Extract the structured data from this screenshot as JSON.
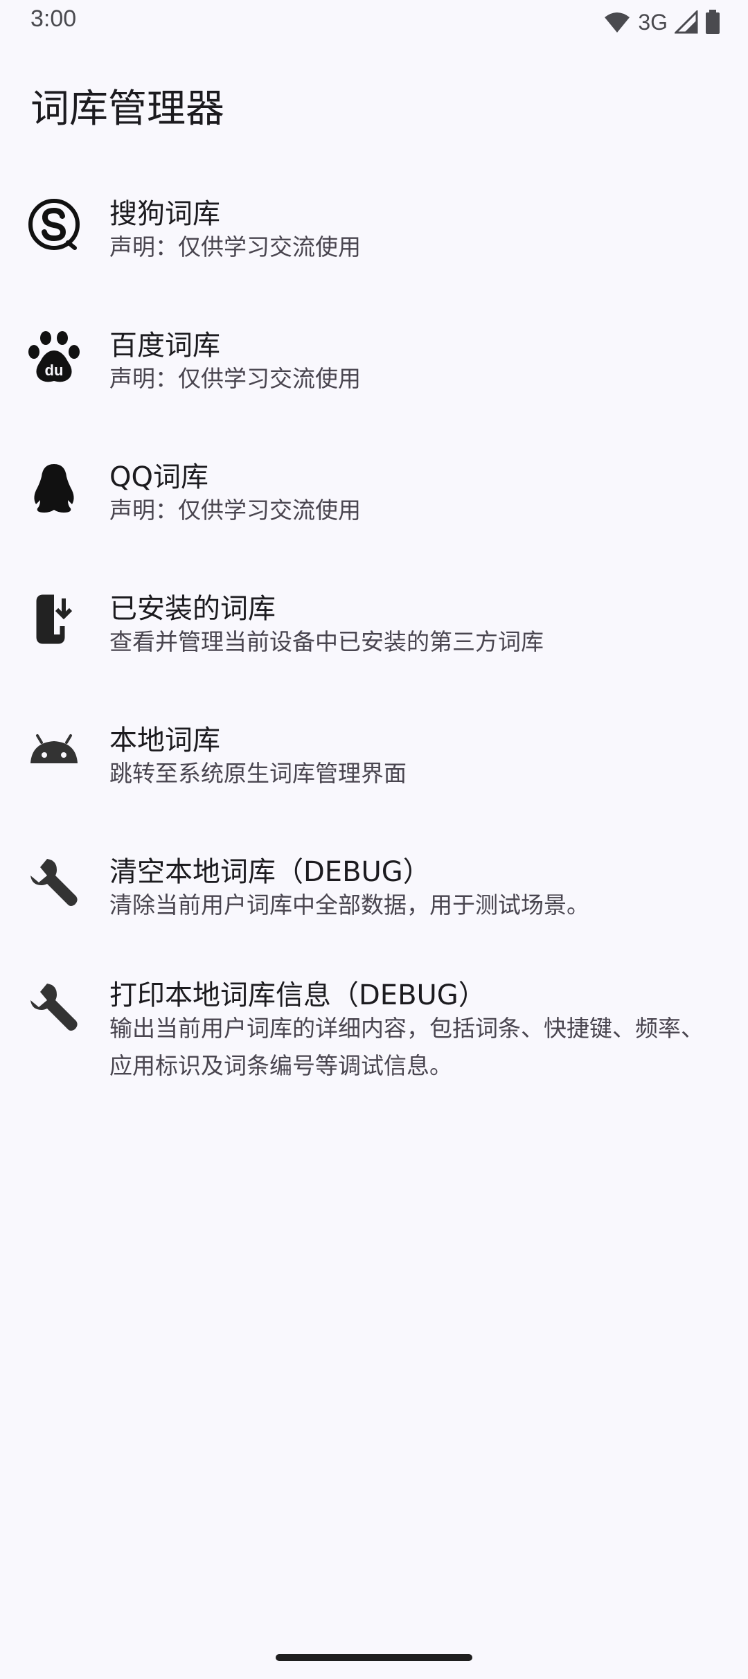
{
  "status_bar": {
    "time": "3:00",
    "network": "3G"
  },
  "title": "词库管理器",
  "items": [
    {
      "icon": "sogou-logo-icon",
      "title": "搜狗词库",
      "subtitle": "声明：仅供学习交流使用"
    },
    {
      "icon": "baidu-paw-icon",
      "title": "百度词库",
      "subtitle": "声明：仅供学习交流使用"
    },
    {
      "icon": "qq-penguin-icon",
      "title": "QQ词库",
      "subtitle": "声明：仅供学习交流使用"
    },
    {
      "icon": "phone-download-icon",
      "title": "已安装的词库",
      "subtitle": "查看并管理当前设备中已安装的第三方词库"
    },
    {
      "icon": "android-icon",
      "title": "本地词库",
      "subtitle": "跳转至系统原生词库管理界面"
    },
    {
      "icon": "wrench-icon",
      "title": "清空本地词库（DEBUG）",
      "subtitle": "清除当前用户词库中全部数据，用于测试场景。"
    },
    {
      "icon": "wrench-icon",
      "title": "打印本地词库信息（DEBUG）",
      "subtitle": "输出当前用户词库的详细内容，包括词条、快捷键、频率、应用标识及词条编号等调试信息。"
    }
  ],
  "colors": {
    "background": "#f9f8fd",
    "text_primary": "#1c1b1f",
    "text_secondary": "#49454f"
  }
}
